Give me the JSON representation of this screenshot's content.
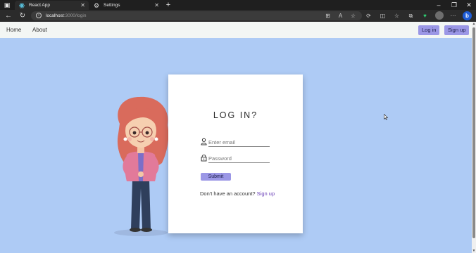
{
  "browser": {
    "tabs": [
      {
        "label": "React App",
        "active": true
      },
      {
        "label": "Settings",
        "active": false
      }
    ],
    "url_host": "localhost",
    "url_path": ":3000/login"
  },
  "navbar": {
    "home": "Home",
    "about": "About",
    "login": "Log in",
    "signup": "Sign up"
  },
  "login_card": {
    "title": "LOG IN?",
    "email_placeholder": "Enter email",
    "password_placeholder": "Password",
    "submit": "Submit",
    "no_account_text": "Don't have an account?",
    "signup_link": "Sign up"
  },
  "colors": {
    "page_background": "#aecbf5",
    "accent": "#9b97e6",
    "link": "#6b40b8"
  }
}
